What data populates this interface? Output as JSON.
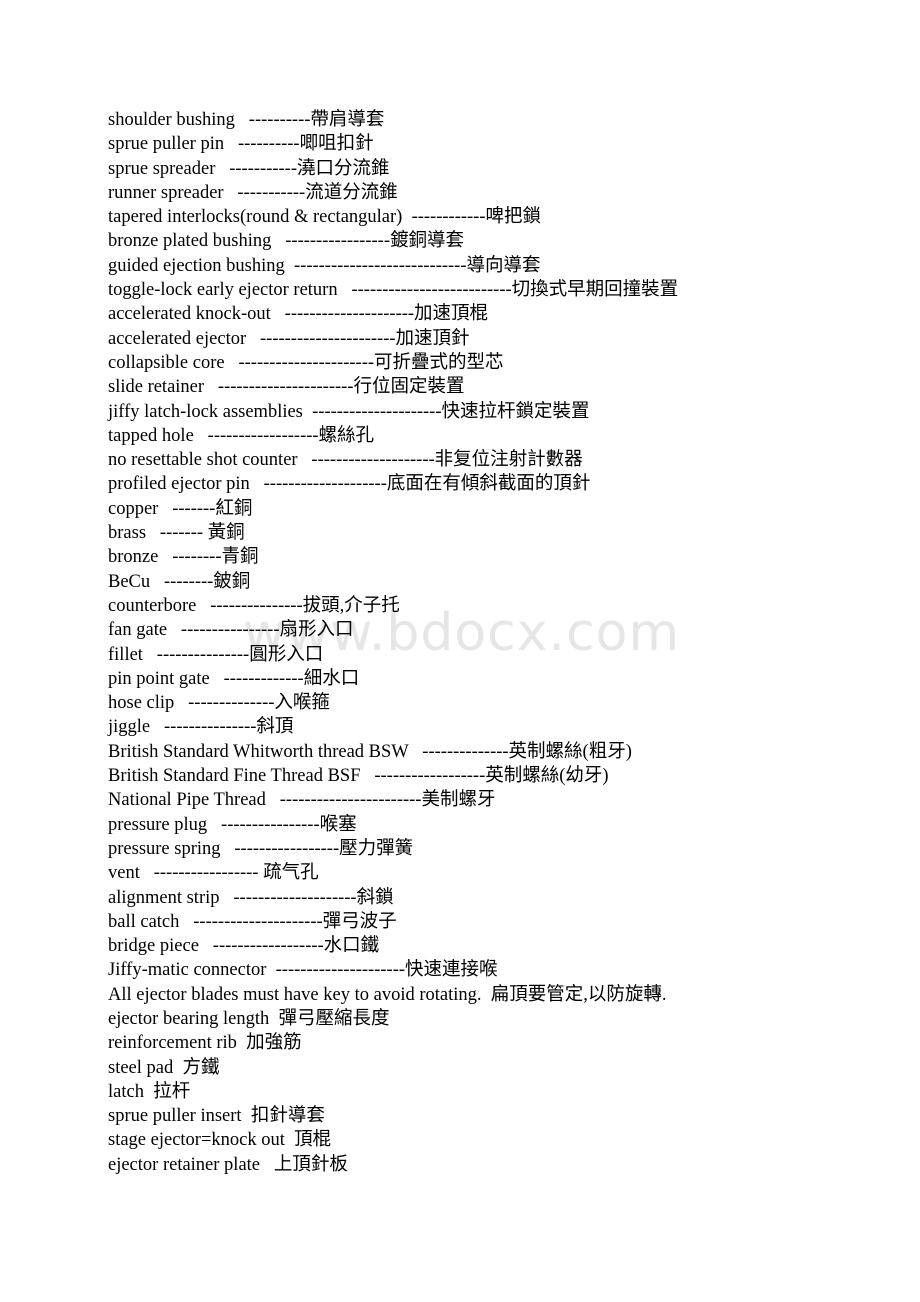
{
  "document": {
    "type": "text-document",
    "page_background": "#ffffff",
    "text_color": "#000000",
    "watermark": {
      "text": "www.bdocx.com",
      "color": "#e6e6e6"
    },
    "lines": [
      "shoulder bushing   ----------帶肩導套",
      "sprue puller pin   ----------唧咀扣針",
      "sprue spreader   -----------澆口分流錐",
      "runner spreader   -----------流道分流錐",
      "tapered interlocks(round & rectangular)  ------------啤把鎖",
      "bronze plated bushing   -----------------鍍銅導套",
      "guided ejection bushing  ----------------------------導向導套",
      "toggle-lock early ejector return   --------------------------切換式早期回撞裝置",
      "accelerated knock-out   ---------------------加速頂棍",
      "accelerated ejector   ----------------------加速頂針",
      "collapsible core   ----------------------可折疊式的型芯",
      "slide retainer   ----------------------行位固定裝置",
      "jiffy latch-lock assemblies  ---------------------快速拉杆鎖定裝置",
      "tapped hole   ------------------螺絲孔",
      "no resettable shot counter   --------------------非复位注射計數器",
      "profiled ejector pin   --------------------底面在有傾斜截面的頂針",
      "copper   -------紅銅",
      "brass   ------- 黃銅",
      "bronze   --------青銅",
      "BeCu   --------鈹銅",
      "counterbore   ---------------拔頭,介子托",
      "fan gate   ----------------扇形入口",
      "fillet   ---------------圓形入口",
      "pin point gate   -------------細水口",
      "hose clip   --------------入喉箍",
      "jiggle   ---------------斜頂",
      "British Standard Whitworth thread BSW   --------------英制螺絲(粗牙)",
      "British Standard Fine Thread BSF   ------------------英制螺絲(幼牙)",
      "National Pipe Thread   -----------------------美制螺牙",
      "pressure plug   ----------------喉塞",
      "pressure spring   -----------------壓力彈簧",
      "vent   ----------------- 疏气孔",
      "alignment strip   --------------------斜鎖",
      "ball catch   ---------------------彈弓波子",
      "bridge piece   ------------------水口鐵",
      "Jiffy-matic connector  ---------------------快速連接喉",
      "All ejector blades must have key to avoid rotating.  扁頂要管定,以防旋轉.",
      "ejector bearing length  彈弓壓縮長度",
      "reinforcement rib  加強筋",
      "steel pad  方鐵",
      "latch  拉杆",
      "sprue puller insert  扣針導套",
      "stage ejector=knock out  頂棍",
      "ejector retainer plate   上頂針板"
    ]
  }
}
